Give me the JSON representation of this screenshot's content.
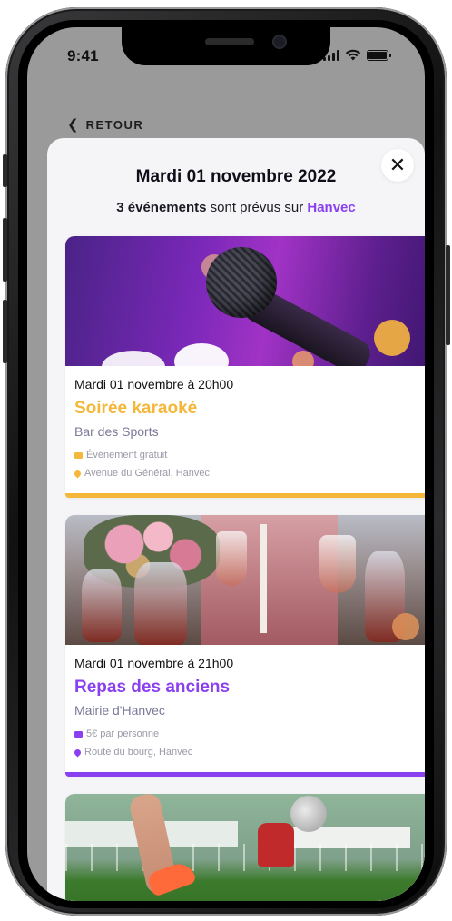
{
  "status_bar": {
    "time": "9:41",
    "icons": [
      "signal-icon",
      "wifi-icon",
      "battery-icon"
    ]
  },
  "nav": {
    "back_label": "RETOUR",
    "back_icon": "chevron-left-icon"
  },
  "sheet": {
    "title": "Mardi 01 novembre 2022",
    "subtitle": {
      "count_text": "3 événements",
      "middle_text": " sont prévus sur ",
      "place": "Hanvec"
    },
    "close_icon": "close-icon"
  },
  "colors": {
    "accent_purple": "#8a3ff0",
    "accent_orange": "#f4b73a",
    "venue_gray": "#7a7a99"
  },
  "events": [
    {
      "date_time": "Mardi 01 novembre à 20h00",
      "title": "Soirée karaoké",
      "title_color": "#f4b73a",
      "venue": "Bar des Sports",
      "price": "Événement gratuit",
      "address": "Avenue du Général, Hanvec",
      "image": "karaoke-microphone-image"
    },
    {
      "date_time": "Mardi 01 novembre à 21h00",
      "title": "Repas des anciens",
      "title_color": "#8a3ff0",
      "venue": "Mairie d'Hanvec",
      "price": "5€ par personne",
      "address": "Route du bourg, Hanvec",
      "image": "dinner-table-image"
    },
    {
      "image": "football-match-image"
    }
  ]
}
